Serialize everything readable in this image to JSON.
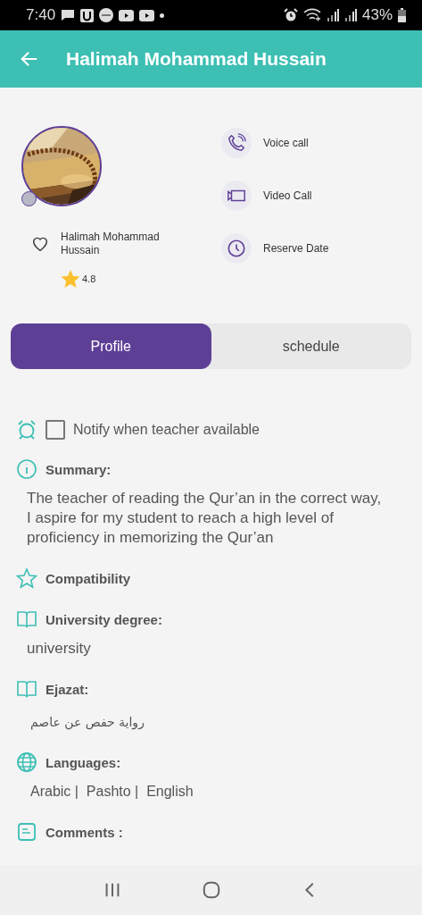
{
  "status_bar": {
    "time": "7:40",
    "battery": "43%"
  },
  "app_bar": {
    "title": "Halimah Mohammad Hussain"
  },
  "profile": {
    "online": false,
    "favorite": false,
    "name": "Halimah Mohammad Hussain",
    "rating": "4.8"
  },
  "actions": [
    {
      "kind": "voice",
      "label": "Voice call"
    },
    {
      "kind": "video",
      "label": "Video Call"
    },
    {
      "kind": "clock",
      "label": "Reserve Date"
    }
  ],
  "tabs": [
    {
      "label": "Profile",
      "selected": true
    },
    {
      "label": "schedule",
      "selected": false
    }
  ],
  "notify": {
    "label": "Notify when teacher available",
    "checked": false
  },
  "sections": [
    {
      "kind": "info",
      "title": "Summary:",
      "text": "The teacher of reading the Qur’an in the correct way, I aspire for my student to reach a high level of proficiency in memorizing the Qur’an"
    },
    {
      "kind": "star",
      "title": "Compatibility"
    },
    {
      "kind": "book",
      "title": "University degree:",
      "text": "university"
    },
    {
      "kind": "book",
      "title": "Ejazat:",
      "text": "رواية حفص عن عاصم",
      "small": true
    },
    {
      "kind": "globe",
      "title": "Languages:",
      "text": "Arabic |  Pashto |  English",
      "indent": true
    },
    {
      "kind": "note",
      "title": "Comments :"
    }
  ]
}
